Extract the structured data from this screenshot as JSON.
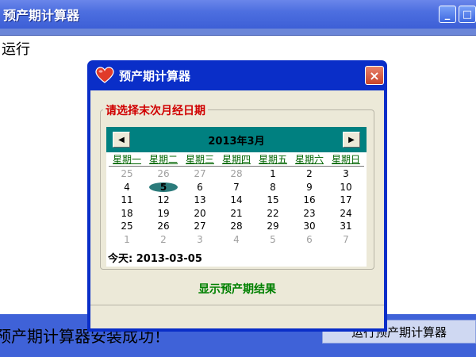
{
  "background_window": {
    "title": "预产期计算器",
    "content_label": "运行",
    "minimize_symbol": "_",
    "maximize_symbol": "□",
    "success_message": "预产期计算器安装成功！",
    "run_button_label": "运行预产期计算器"
  },
  "dialog": {
    "title": "预产期计算器",
    "close_symbol": "×",
    "group_label": "请选择末次月经日期",
    "calendar": {
      "month_label": "2013年3月",
      "prev_symbol": "◀",
      "next_symbol": "▶",
      "weekdays": [
        "星期一",
        "星期二",
        "星期三",
        "星期四",
        "星期五",
        "星期六",
        "星期日"
      ],
      "weeks": [
        [
          {
            "d": "25",
            "o": true
          },
          {
            "d": "26",
            "o": true
          },
          {
            "d": "27",
            "o": true
          },
          {
            "d": "28",
            "o": true
          },
          {
            "d": "1"
          },
          {
            "d": "2"
          },
          {
            "d": "3"
          }
        ],
        [
          {
            "d": "4"
          },
          {
            "d": "5",
            "sel": true
          },
          {
            "d": "6"
          },
          {
            "d": "7"
          },
          {
            "d": "8"
          },
          {
            "d": "9"
          },
          {
            "d": "10"
          }
        ],
        [
          {
            "d": "11"
          },
          {
            "d": "12"
          },
          {
            "d": "13"
          },
          {
            "d": "14"
          },
          {
            "d": "15"
          },
          {
            "d": "16"
          },
          {
            "d": "17"
          }
        ],
        [
          {
            "d": "18"
          },
          {
            "d": "19"
          },
          {
            "d": "20"
          },
          {
            "d": "21"
          },
          {
            "d": "22"
          },
          {
            "d": "23"
          },
          {
            "d": "24"
          }
        ],
        [
          {
            "d": "25"
          },
          {
            "d": "26"
          },
          {
            "d": "27"
          },
          {
            "d": "28"
          },
          {
            "d": "29"
          },
          {
            "d": "30"
          },
          {
            "d": "31"
          }
        ],
        [
          {
            "d": "1",
            "o": true
          },
          {
            "d": "2",
            "o": true
          },
          {
            "d": "3",
            "o": true
          },
          {
            "d": "4",
            "o": true
          },
          {
            "d": "5",
            "o": true
          },
          {
            "d": "6",
            "o": true
          },
          {
            "d": "7",
            "o": true
          }
        ]
      ],
      "today_label": "今天:",
      "today_value": "2013-03-05"
    },
    "show_result_label": "显示预产期结果"
  },
  "colors": {
    "titlebar_blue": "#3d5fd6",
    "dialog_frame": "#0a2ec8",
    "calendar_header": "#008080",
    "group_label_red": "#d00000",
    "result_green": "#008000"
  }
}
